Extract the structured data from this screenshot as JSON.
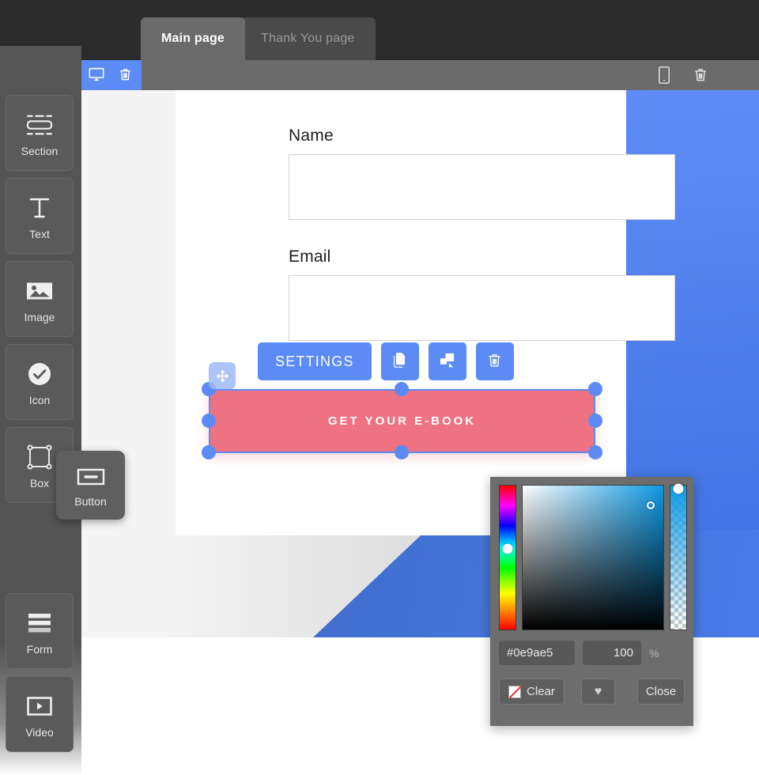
{
  "app": {
    "accent_blue": "#5c8bf5",
    "cta_pink": "#ef7283",
    "sidebar_grey": "#555555",
    "topbar_dark": "#2b2b2b"
  },
  "topbar": {
    "tabs": [
      {
        "label": "Main page",
        "active": true
      },
      {
        "label": "Thank You page",
        "active": false
      }
    ]
  },
  "subtoolbar": {
    "left_icons": [
      {
        "name": "desktop-view-icon",
        "label": "Desktop view"
      },
      {
        "name": "delete-section-icon",
        "label": "Delete"
      }
    ],
    "right_icons": [
      {
        "name": "mobile-view-icon",
        "label": "Mobile view"
      },
      {
        "name": "delete-icon",
        "label": "Delete"
      }
    ]
  },
  "sidebar": {
    "items": [
      {
        "label": "Section",
        "icon": "section-icon"
      },
      {
        "label": "Text",
        "icon": "text-icon"
      },
      {
        "label": "Image",
        "icon": "image-icon"
      },
      {
        "label": "Icon",
        "icon": "check-circle-icon"
      },
      {
        "label": "Box",
        "icon": "box-icon"
      },
      {
        "label": "Form",
        "icon": "form-icon"
      },
      {
        "label": "Video",
        "icon": "video-icon"
      }
    ],
    "dragging_tool": {
      "label": "Button",
      "icon": "button-icon"
    }
  },
  "canvas": {
    "form": {
      "fields": [
        {
          "label": "Name",
          "value": "",
          "placeholder": ""
        },
        {
          "label": "Email",
          "value": "",
          "placeholder": ""
        }
      ]
    },
    "cta_button": {
      "label": "GET YOUR E-BOOK"
    }
  },
  "element_toolbar": {
    "settings_label": "SETTINGS",
    "icons": [
      {
        "name": "duplicate-icon",
        "label": "Duplicate"
      },
      {
        "name": "resize-icon",
        "label": "Resize"
      },
      {
        "name": "delete-icon",
        "label": "Delete"
      }
    ],
    "drag_handle": {
      "name": "move-handle",
      "label": "Move"
    }
  },
  "color_picker": {
    "hex": "#0e9ae5",
    "alpha": "100",
    "alpha_unit": "%",
    "clear_label": "Clear",
    "favorite_label": "♥",
    "close_label": "Close"
  }
}
